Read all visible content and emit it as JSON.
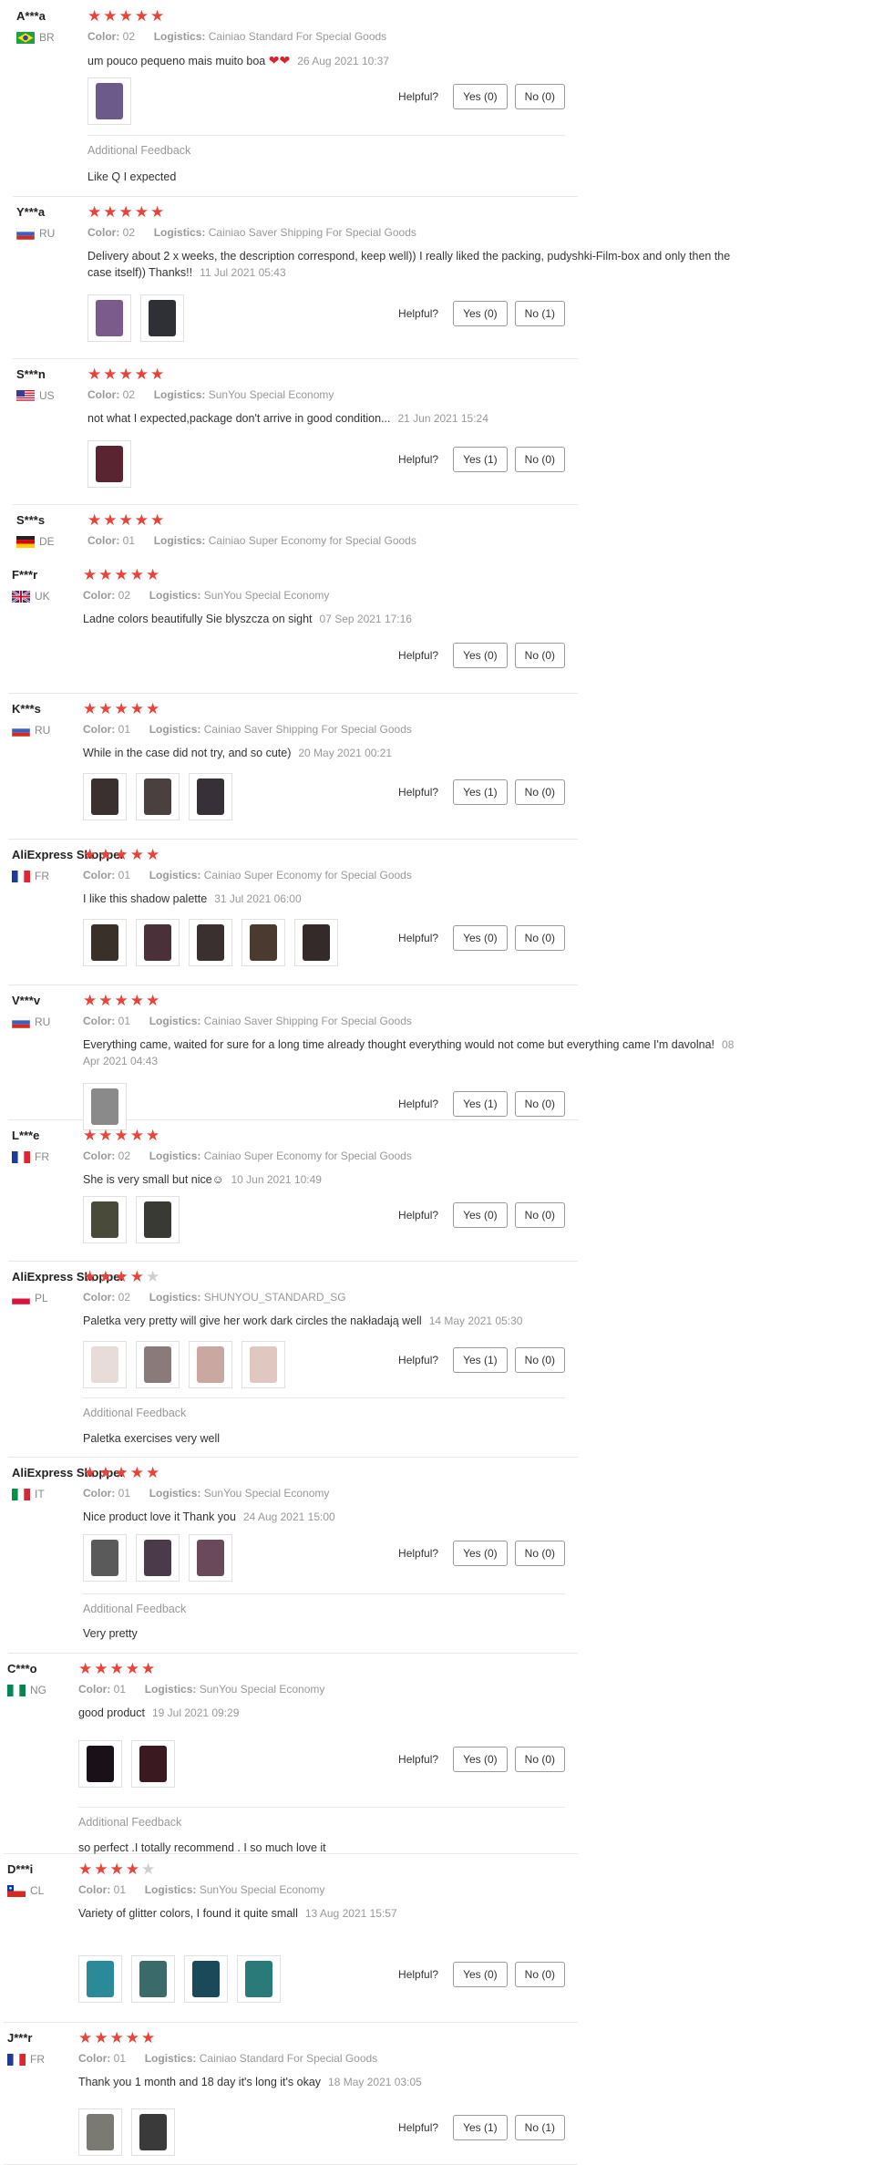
{
  "helpful_label": "Helpful?",
  "additional_feedback_label": "Additional Feedback",
  "color_label": "Color:",
  "logistics_label": "Logistics:",
  "reviews": [
    {
      "user": "A***a",
      "country": "BR",
      "stars": 5,
      "color": "02",
      "logistics": "Cainiao Standard For Special Goods",
      "text": "um pouco pequeno mais muito boa",
      "hearts": "❤❤",
      "date": "26 Aug 2021 10:37",
      "photos": [
        "#6b5a8a"
      ],
      "yes": "Yes (0)",
      "no": "No (0)",
      "feedback": "Like Q I expected"
    },
    {
      "user": "Y***a",
      "country": "RU",
      "stars": 5,
      "color": "02",
      "logistics": "Cainiao Saver Shipping For Special Goods",
      "text": "Delivery about 2 x weeks, the description correspond, keep well)) I really liked the packing, pudyshki-Film-box and only then the case itself)) Thanks!!",
      "date": "11 Jul 2021 05:43",
      "photos": [
        "#7a5b8c",
        "#2f2f36"
      ],
      "yes": "Yes (0)",
      "no": "No (1)"
    },
    {
      "user": "S***n",
      "country": "US",
      "stars": 5,
      "color": "02",
      "logistics": "SunYou Special Economy",
      "text": "not what I expected,package don't arrive in good condition...",
      "date": "21 Jun 2021 15:24",
      "photos": [
        "#5a2430"
      ],
      "yes": "Yes (1)",
      "no": "No (0)"
    },
    {
      "user": "S***s",
      "country": "DE",
      "stars": 5,
      "color": "01",
      "logistics": "Cainiao Super Economy for Special Goods"
    },
    {
      "user": "F***r",
      "country": "UK",
      "stars": 5,
      "color": "02",
      "logistics": "SunYou Special Economy",
      "text": "Ladne colors beautifully Sie blyszcza on sight",
      "date": "07 Sep 2021 17:16",
      "yes": "Yes (0)",
      "no": "No (0)"
    },
    {
      "user": "K***s",
      "country": "RU",
      "stars": 5,
      "color": "01",
      "logistics": "Cainiao Saver Shipping For Special Goods",
      "text": "While in the case did not try, and so cute)",
      "date": "20 May 2021 00:21",
      "photos": [
        "#3a3030",
        "#4a4040",
        "#383038"
      ],
      "yes": "Yes (1)",
      "no": "No (0)"
    },
    {
      "user": "AliExpress Shopper",
      "country": "FR",
      "stars": 5,
      "color": "01",
      "logistics": "Cainiao Super Economy for Special Goods",
      "text": "I like this shadow palette",
      "date": "31 Jul 2021 06:00",
      "photos": [
        "#3a302a",
        "#4a3038",
        "#3a3030",
        "#4a3a30",
        "#352a2a"
      ],
      "yes": "Yes (0)",
      "no": "No (0)"
    },
    {
      "user": "V***v",
      "country": "RU",
      "stars": 5,
      "color": "01",
      "logistics": "Cainiao Saver Shipping For Special Goods",
      "text": "Everything came, waited for sure for a long time already thought everything would not come but everything came I'm davolna!",
      "date": "08 Apr 2021 04:43",
      "photos": [
        "#8a8a8a"
      ],
      "yes": "Yes (1)",
      "no": "No (0)"
    },
    {
      "user": "L***e",
      "country": "FR",
      "stars": 5,
      "color": "02",
      "logistics": "Cainiao Super Economy for Special Goods",
      "text": "She is very small but nice☺",
      "date": "10 Jun 2021 10:49",
      "photos": [
        "#4a4a3a",
        "#3a3a34"
      ],
      "yes": "Yes (0)",
      "no": "No (0)"
    },
    {
      "user": "AliExpress Shopper",
      "country": "PL",
      "stars": 4,
      "color": "02",
      "logistics": "SHUNYOU_STANDARD_SG",
      "text": "Paletka very pretty will give her work dark circles the nakładają well",
      "date": "14 May 2021 05:30",
      "photos": [
        "#e8dcd8",
        "#8a7a7a",
        "#c8a8a0",
        "#e0c8c0"
      ],
      "yes": "Yes (1)",
      "no": "No (0)",
      "feedback": "Paletka exercises very well"
    },
    {
      "user": "AliExpress Shopper",
      "country": "IT",
      "stars": 5,
      "color": "01",
      "logistics": "SunYou Special Economy",
      "text": "Nice product love it Thank you",
      "date": "24 Aug 2021 15:00",
      "photos": [
        "#5a5a5a",
        "#4a3a4a",
        "#6a4a5a"
      ],
      "yes": "Yes (0)",
      "no": "No (0)",
      "feedback": "Very pretty"
    },
    {
      "user": "C***o",
      "country": "NG",
      "stars": 5,
      "color": "01",
      "logistics": "SunYou Special Economy",
      "text": "good product",
      "date": "19 Jul 2021 09:29",
      "photos": [
        "#1a1018",
        "#3a1a20"
      ],
      "yes": "Yes (0)",
      "no": "No (0)",
      "feedback": "so perfect .I totally recommend . I so much love it"
    },
    {
      "user": "D***i",
      "country": "CL",
      "stars": 4,
      "color": "01",
      "logistics": "SunYou Special Economy",
      "text": "Variety of glitter colors, I found it quite small",
      "date": "13 Aug 2021 15:57",
      "photos": [
        "#2a8a9a",
        "#3a6a6a",
        "#1a4a5a",
        "#2a7a7a"
      ],
      "yes": "Yes (0)",
      "no": "No (0)"
    },
    {
      "user": "J***r",
      "country": "FR",
      "stars": 5,
      "color": "01",
      "logistics": "Cainiao Standard For Special Goods",
      "text": "Thank you 1 month and 18 day it's long it's okay",
      "date": "18 May 2021 03:05",
      "photos": [
        "#7a7a72",
        "#3a3a3a"
      ],
      "yes": "Yes (1)",
      "no": "No (1)"
    }
  ]
}
